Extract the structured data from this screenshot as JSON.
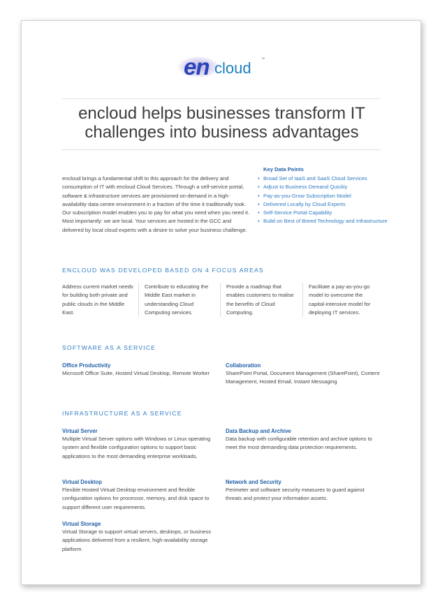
{
  "logo": {
    "part1": "en",
    "part2": "cloud",
    "tm": "™"
  },
  "headline": "encloud helps businesses transform IT challenges into business advantages",
  "intro": "encloud brings a fundamental shift to this approach for the delivery and consumption of IT with encloud Cloud Services.  Through a self-service portal, software & infrastructure services are provisioned on-demand in a high-availability data centre environment in a fraction of the time it traditionally took. Our subscription model enables you to pay for what you need when you need it. Most importantly: we are local. Your services are hosted in the GCC and delivered by local cloud experts with a desire to solve your business challenge.",
  "key_points": {
    "title": "Key Data Points",
    "items": [
      "Broad Set of IaaS and SaaS Cloud Services",
      "Adjust to Business Demand Quickly",
      "Pay-as-you-Grow Subscription Model",
      "Delivered Locally by Cloud Experts",
      "Self-Service Portal Capability",
      "Build on Best of Breed Technology and Infrastructure"
    ]
  },
  "focus": {
    "heading": "ENCLOUD WAS DEVELOPED BASED ON 4 FOCUS AREAS",
    "items": [
      "Address current market needs for building both private and public clouds in the Middle East.",
      "Contribute to educating the Middle East market in understanding Cloud Computing services.",
      "Provide a roadmap that enables customers to realise the benefits of Cloud Computing.",
      "Facilitate a pay-as-you-go model to overcome the capital-intensive model for deploying IT services."
    ]
  },
  "saas": {
    "heading": "SOFTWARE AS A SERVICE",
    "items": [
      {
        "title": "Office Productivity",
        "desc": "Microsoft Office Suite, Hosted Virtual Desktop, Remote Worker"
      },
      {
        "title": "Collaboration",
        "desc": "SharePoint Portal, Document Management (SharePoint), Content Management, Hosted Email, Instant Messaging"
      }
    ]
  },
  "iaas": {
    "heading": "INFRASTRUCTURE AS A SERVICE",
    "items": [
      {
        "title": "Virtual Server",
        "desc": "Multiple Virtual Server options with Windows or Linux operating system and flexible configuration options to support basic applications to the most demanding enterprise workloads."
      },
      {
        "title": "Data Backup and Archive",
        "desc": "Data backup with configurable retention and archive options to meet the most demanding data protection requirements."
      },
      {
        "title": "Virtual Desktop",
        "desc": "Flexible Hosted Virtual Desktop environment and flexible configuration options for processor, memory, and disk space to support different user requirements."
      },
      {
        "title": "Network and Security",
        "desc": "Perimeter and software security measures to guard against threats and protect your information assets."
      },
      {
        "title": "Virtual Storage",
        "desc": "Virtual Storage to support virtual servers, desktops, or business applications delivered from a resilient, high-availability storage platform."
      }
    ]
  },
  "colors": {
    "accent": "#2e7bc4",
    "title_blue": "#1f5fa8",
    "body_text": "#444444"
  }
}
